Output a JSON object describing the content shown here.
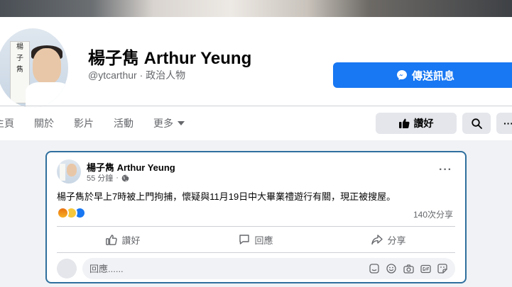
{
  "page": {
    "name": "楊子雋 Arthur Yeung",
    "handle": "@ytcarthur",
    "category_separator": " · ",
    "category": "政治人物",
    "avatar_sign": [
      "楊",
      "子",
      "雋"
    ],
    "avatar_small_text": "Arthur Yeung"
  },
  "header_buttons": {
    "message_label": "傳送訊息",
    "like_label": "讚好",
    "more_label": "···"
  },
  "tabs": [
    {
      "label": "主頁"
    },
    {
      "label": "關於"
    },
    {
      "label": "影片"
    },
    {
      "label": "活動"
    },
    {
      "label": "更多"
    }
  ],
  "post": {
    "author": "楊子雋 Arthur Yeung",
    "time": "55 分鐘",
    "meta_separator": " · ",
    "text": "楊子雋於早上7時被上門拘捕，懷疑與11月19日中大畢業禮遊行有關，現正被搜屋。",
    "reactions": [
      "angry",
      "sad",
      "like"
    ],
    "shares": "140次分享",
    "actions": {
      "like": "讚好",
      "comment": "回應",
      "share": "分享"
    },
    "comment_placeholder": "回應......"
  },
  "colors": {
    "brand_blue": "#1877f2",
    "post_border": "#2f6f9e",
    "secondary_text": "#65676b",
    "button_gray": "#e4e6eb"
  },
  "icons": [
    "messenger-icon",
    "thumbs-up-icon",
    "search-icon",
    "chevron-down-icon",
    "globe-icon",
    "more-dots-icon",
    "comment-icon",
    "share-icon",
    "sticker-icon",
    "emoji-icon",
    "camera-icon",
    "gif-icon",
    "avatar-sticker-icon"
  ]
}
